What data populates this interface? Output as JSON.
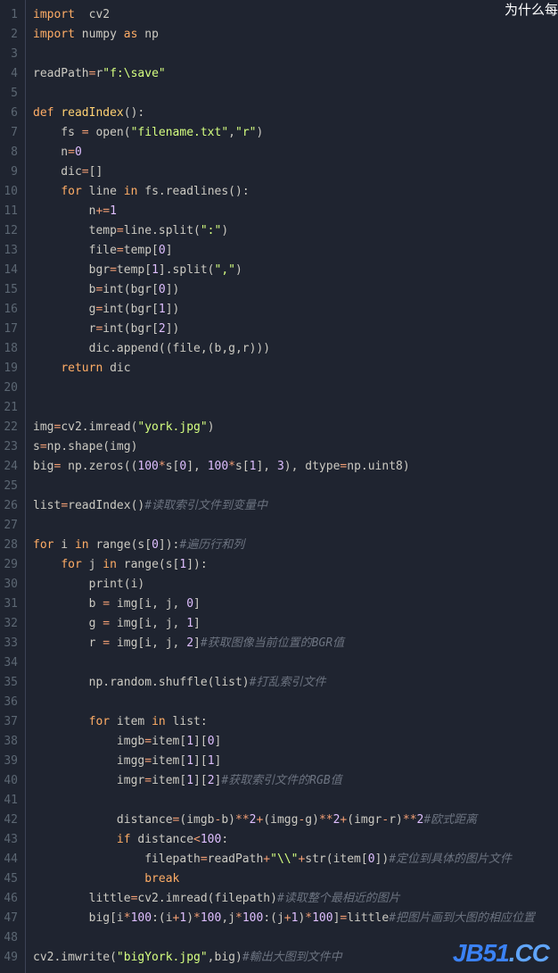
{
  "truncated_header": "为什么每",
  "watermark": {
    "part1": "JB51",
    "part2": ".CC"
  },
  "lines": [
    {
      "n": 1,
      "tokens": [
        [
          "kw",
          "import"
        ],
        [
          "id",
          "  cv2"
        ]
      ]
    },
    {
      "n": 2,
      "tokens": [
        [
          "kw",
          "import"
        ],
        [
          "id",
          " numpy "
        ],
        [
          "kw",
          "as"
        ],
        [
          "id",
          " np"
        ]
      ]
    },
    {
      "n": 3,
      "tokens": [
        [
          "id",
          ""
        ]
      ]
    },
    {
      "n": 4,
      "tokens": [
        [
          "id",
          "readPath"
        ],
        [
          "op",
          "="
        ],
        [
          "id",
          "r"
        ],
        [
          "str",
          "\"f:\\save\""
        ]
      ]
    },
    {
      "n": 5,
      "tokens": [
        [
          "id",
          ""
        ]
      ]
    },
    {
      "n": 6,
      "tokens": [
        [
          "kw",
          "def"
        ],
        [
          "id",
          " "
        ],
        [
          "fn",
          "readIndex"
        ],
        [
          "id",
          "():"
        ]
      ]
    },
    {
      "n": 7,
      "tokens": [
        [
          "id",
          "    fs "
        ],
        [
          "op",
          "="
        ],
        [
          "id",
          " open("
        ],
        [
          "str",
          "\"filename.txt\""
        ],
        [
          "id",
          ","
        ],
        [
          "str",
          "\"r\""
        ],
        [
          "id",
          ")"
        ]
      ]
    },
    {
      "n": 8,
      "tokens": [
        [
          "id",
          "    n"
        ],
        [
          "op",
          "="
        ],
        [
          "num",
          "0"
        ]
      ]
    },
    {
      "n": 9,
      "tokens": [
        [
          "id",
          "    dic"
        ],
        [
          "op",
          "="
        ],
        [
          "id",
          "[]"
        ]
      ]
    },
    {
      "n": 10,
      "tokens": [
        [
          "id",
          "    "
        ],
        [
          "kw",
          "for"
        ],
        [
          "id",
          " line "
        ],
        [
          "kw",
          "in"
        ],
        [
          "id",
          " fs.readlines():"
        ]
      ]
    },
    {
      "n": 11,
      "tokens": [
        [
          "id",
          "        n"
        ],
        [
          "op",
          "+="
        ],
        [
          "num",
          "1"
        ]
      ]
    },
    {
      "n": 12,
      "tokens": [
        [
          "id",
          "        temp"
        ],
        [
          "op",
          "="
        ],
        [
          "id",
          "line.split("
        ],
        [
          "str",
          "\":\""
        ],
        [
          "id",
          ")"
        ]
      ]
    },
    {
      "n": 13,
      "tokens": [
        [
          "id",
          "        file"
        ],
        [
          "op",
          "="
        ],
        [
          "id",
          "temp["
        ],
        [
          "num",
          "0"
        ],
        [
          "id",
          "]"
        ]
      ]
    },
    {
      "n": 14,
      "tokens": [
        [
          "id",
          "        bgr"
        ],
        [
          "op",
          "="
        ],
        [
          "id",
          "temp["
        ],
        [
          "num",
          "1"
        ],
        [
          "id",
          "].split("
        ],
        [
          "str",
          "\",\""
        ],
        [
          "id",
          ")"
        ]
      ]
    },
    {
      "n": 15,
      "tokens": [
        [
          "id",
          "        b"
        ],
        [
          "op",
          "="
        ],
        [
          "id",
          "int(bgr["
        ],
        [
          "num",
          "0"
        ],
        [
          "id",
          "])"
        ]
      ]
    },
    {
      "n": 16,
      "tokens": [
        [
          "id",
          "        g"
        ],
        [
          "op",
          "="
        ],
        [
          "id",
          "int(bgr["
        ],
        [
          "num",
          "1"
        ],
        [
          "id",
          "])"
        ]
      ]
    },
    {
      "n": 17,
      "tokens": [
        [
          "id",
          "        r"
        ],
        [
          "op",
          "="
        ],
        [
          "id",
          "int(bgr["
        ],
        [
          "num",
          "2"
        ],
        [
          "id",
          "])"
        ]
      ]
    },
    {
      "n": 18,
      "tokens": [
        [
          "id",
          "        dic.append((file,(b,g,r)))"
        ]
      ]
    },
    {
      "n": 19,
      "tokens": [
        [
          "id",
          "    "
        ],
        [
          "kw",
          "return"
        ],
        [
          "id",
          " dic"
        ]
      ]
    },
    {
      "n": 20,
      "tokens": [
        [
          "id",
          ""
        ]
      ]
    },
    {
      "n": 21,
      "tokens": [
        [
          "id",
          ""
        ]
      ]
    },
    {
      "n": 22,
      "tokens": [
        [
          "id",
          "img"
        ],
        [
          "op",
          "="
        ],
        [
          "id",
          "cv2.imread("
        ],
        [
          "str",
          "\"york.jpg\""
        ],
        [
          "id",
          ")"
        ]
      ]
    },
    {
      "n": 23,
      "tokens": [
        [
          "id",
          "s"
        ],
        [
          "op",
          "="
        ],
        [
          "id",
          "np.shape(img)"
        ]
      ]
    },
    {
      "n": 24,
      "tokens": [
        [
          "id",
          "big"
        ],
        [
          "op",
          "="
        ],
        [
          "id",
          " np.zeros(("
        ],
        [
          "num",
          "100"
        ],
        [
          "op",
          "*"
        ],
        [
          "id",
          "s["
        ],
        [
          "num",
          "0"
        ],
        [
          "id",
          "], "
        ],
        [
          "num",
          "100"
        ],
        [
          "op",
          "*"
        ],
        [
          "id",
          "s["
        ],
        [
          "num",
          "1"
        ],
        [
          "id",
          "], "
        ],
        [
          "num",
          "3"
        ],
        [
          "id",
          "), dtype"
        ],
        [
          "op",
          "="
        ],
        [
          "id",
          "np.uint8)"
        ]
      ]
    },
    {
      "n": 25,
      "tokens": [
        [
          "id",
          ""
        ]
      ]
    },
    {
      "n": 26,
      "tokens": [
        [
          "id",
          "list"
        ],
        [
          "op",
          "="
        ],
        [
          "id",
          "readIndex()"
        ],
        [
          "cm",
          "#读取索引文件到变量中"
        ]
      ]
    },
    {
      "n": 27,
      "tokens": [
        [
          "id",
          ""
        ]
      ]
    },
    {
      "n": 28,
      "tokens": [
        [
          "kw",
          "for"
        ],
        [
          "id",
          " i "
        ],
        [
          "kw",
          "in"
        ],
        [
          "id",
          " range(s["
        ],
        [
          "num",
          "0"
        ],
        [
          "id",
          "]):"
        ],
        [
          "cm",
          "#遍历行和列"
        ]
      ]
    },
    {
      "n": 29,
      "tokens": [
        [
          "id",
          "    "
        ],
        [
          "kw",
          "for"
        ],
        [
          "id",
          " j "
        ],
        [
          "kw",
          "in"
        ],
        [
          "id",
          " range(s["
        ],
        [
          "num",
          "1"
        ],
        [
          "id",
          "]):"
        ]
      ]
    },
    {
      "n": 30,
      "tokens": [
        [
          "id",
          "        print(i)"
        ]
      ]
    },
    {
      "n": 31,
      "tokens": [
        [
          "id",
          "        b "
        ],
        [
          "op",
          "="
        ],
        [
          "id",
          " img[i, j, "
        ],
        [
          "num",
          "0"
        ],
        [
          "id",
          "]"
        ]
      ]
    },
    {
      "n": 32,
      "tokens": [
        [
          "id",
          "        g "
        ],
        [
          "op",
          "="
        ],
        [
          "id",
          " img[i, j, "
        ],
        [
          "num",
          "1"
        ],
        [
          "id",
          "]"
        ]
      ]
    },
    {
      "n": 33,
      "tokens": [
        [
          "id",
          "        r "
        ],
        [
          "op",
          "="
        ],
        [
          "id",
          " img[i, j, "
        ],
        [
          "num",
          "2"
        ],
        [
          "id",
          "]"
        ],
        [
          "cm",
          "#获取图像当前位置的BGR值"
        ]
      ]
    },
    {
      "n": 34,
      "tokens": [
        [
          "id",
          ""
        ]
      ]
    },
    {
      "n": 35,
      "tokens": [
        [
          "id",
          "        np.random.shuffle(list)"
        ],
        [
          "cm",
          "#打乱索引文件"
        ]
      ]
    },
    {
      "n": 36,
      "tokens": [
        [
          "id",
          ""
        ]
      ]
    },
    {
      "n": 37,
      "tokens": [
        [
          "id",
          "        "
        ],
        [
          "kw",
          "for"
        ],
        [
          "id",
          " item "
        ],
        [
          "kw",
          "in"
        ],
        [
          "id",
          " list:"
        ]
      ]
    },
    {
      "n": 38,
      "tokens": [
        [
          "id",
          "            imgb"
        ],
        [
          "op",
          "="
        ],
        [
          "id",
          "item["
        ],
        [
          "num",
          "1"
        ],
        [
          "id",
          "]["
        ],
        [
          "num",
          "0"
        ],
        [
          "id",
          "]"
        ]
      ]
    },
    {
      "n": 39,
      "tokens": [
        [
          "id",
          "            imgg"
        ],
        [
          "op",
          "="
        ],
        [
          "id",
          "item["
        ],
        [
          "num",
          "1"
        ],
        [
          "id",
          "]["
        ],
        [
          "num",
          "1"
        ],
        [
          "id",
          "]"
        ]
      ]
    },
    {
      "n": 40,
      "tokens": [
        [
          "id",
          "            imgr"
        ],
        [
          "op",
          "="
        ],
        [
          "id",
          "item["
        ],
        [
          "num",
          "1"
        ],
        [
          "id",
          "]["
        ],
        [
          "num",
          "2"
        ],
        [
          "id",
          "]"
        ],
        [
          "cm",
          "#获取索引文件的RGB值"
        ]
      ]
    },
    {
      "n": 41,
      "tokens": [
        [
          "id",
          ""
        ]
      ]
    },
    {
      "n": 42,
      "tokens": [
        [
          "id",
          "            distance"
        ],
        [
          "op",
          "="
        ],
        [
          "id",
          "(imgb"
        ],
        [
          "op",
          "-"
        ],
        [
          "id",
          "b)"
        ],
        [
          "op",
          "**"
        ],
        [
          "num",
          "2"
        ],
        [
          "op",
          "+"
        ],
        [
          "id",
          "(imgg"
        ],
        [
          "op",
          "-"
        ],
        [
          "id",
          "g)"
        ],
        [
          "op",
          "**"
        ],
        [
          "num",
          "2"
        ],
        [
          "op",
          "+"
        ],
        [
          "id",
          "(imgr"
        ],
        [
          "op",
          "-"
        ],
        [
          "id",
          "r)"
        ],
        [
          "op",
          "**"
        ],
        [
          "num",
          "2"
        ],
        [
          "cm",
          "#欧式距离"
        ]
      ]
    },
    {
      "n": 43,
      "tokens": [
        [
          "id",
          "            "
        ],
        [
          "kw",
          "if"
        ],
        [
          "id",
          " distance"
        ],
        [
          "op",
          "<"
        ],
        [
          "num",
          "100"
        ],
        [
          "id",
          ":"
        ]
      ]
    },
    {
      "n": 44,
      "tokens": [
        [
          "id",
          "                filepath"
        ],
        [
          "op",
          "="
        ],
        [
          "id",
          "readPath"
        ],
        [
          "op",
          "+"
        ],
        [
          "str",
          "\"\\\\\""
        ],
        [
          "op",
          "+"
        ],
        [
          "id",
          "str(item["
        ],
        [
          "num",
          "0"
        ],
        [
          "id",
          "])"
        ],
        [
          "cm",
          "#定位到具体的图片文件"
        ]
      ]
    },
    {
      "n": 45,
      "tokens": [
        [
          "id",
          "                "
        ],
        [
          "kw",
          "break"
        ]
      ]
    },
    {
      "n": 46,
      "tokens": [
        [
          "id",
          "        little"
        ],
        [
          "op",
          "="
        ],
        [
          "id",
          "cv2.imread(filepath)"
        ],
        [
          "cm",
          "#读取整个最相近的图片"
        ]
      ]
    },
    {
      "n": 47,
      "tokens": [
        [
          "id",
          "        big[i"
        ],
        [
          "op",
          "*"
        ],
        [
          "num",
          "100"
        ],
        [
          "id",
          ":(i"
        ],
        [
          "op",
          "+"
        ],
        [
          "num",
          "1"
        ],
        [
          "id",
          ")"
        ],
        [
          "op",
          "*"
        ],
        [
          "num",
          "100"
        ],
        [
          "id",
          ",j"
        ],
        [
          "op",
          "*"
        ],
        [
          "num",
          "100"
        ],
        [
          "id",
          ":(j"
        ],
        [
          "op",
          "+"
        ],
        [
          "num",
          "1"
        ],
        [
          "id",
          ")"
        ],
        [
          "op",
          "*"
        ],
        [
          "num",
          "100"
        ],
        [
          "id",
          "]"
        ],
        [
          "op",
          "="
        ],
        [
          "id",
          "little"
        ],
        [
          "cm",
          "#把图片画到大图的相应位置"
        ]
      ]
    },
    {
      "n": 48,
      "tokens": [
        [
          "id",
          ""
        ]
      ]
    },
    {
      "n": 49,
      "tokens": [
        [
          "id",
          "cv2.imwrite("
        ],
        [
          "str",
          "\"bigYork.jpg\""
        ],
        [
          "id",
          ",big)"
        ],
        [
          "cm",
          "#輸出大图到文件中"
        ]
      ]
    }
  ]
}
